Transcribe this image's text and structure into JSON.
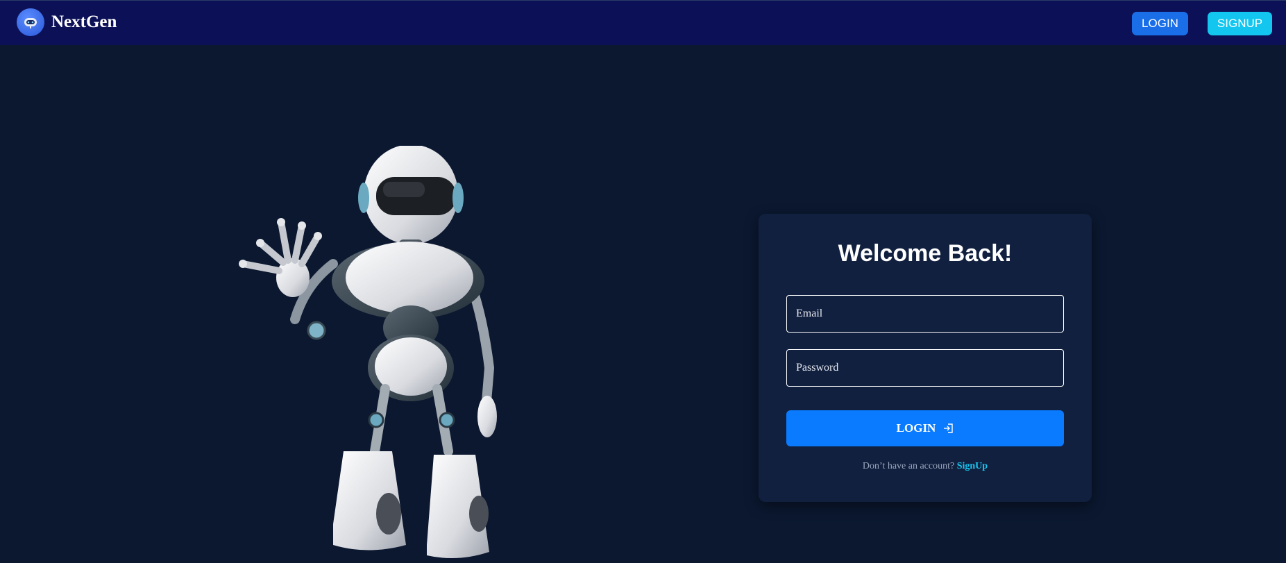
{
  "navbar": {
    "brand_name": "NextGen",
    "logo_icon": "robot-face-icon",
    "login_label": "LOGIN",
    "signup_label": "SIGNUP"
  },
  "hero": {
    "illustration": "waving-robot-illustration"
  },
  "login_card": {
    "title": "Welcome Back!",
    "email_placeholder": "Email",
    "password_placeholder": "Password",
    "submit_label": "LOGIN",
    "submit_icon": "login-arrow-icon",
    "signup_prompt": "Don’t have an account?",
    "signup_link": "SignUp"
  },
  "colors": {
    "page_background": "#0b1830",
    "navbar_background": "#0c1157",
    "card_background": "#12203f",
    "primary_button": "#0a7bff",
    "signup_accent": "#12c6ef"
  }
}
